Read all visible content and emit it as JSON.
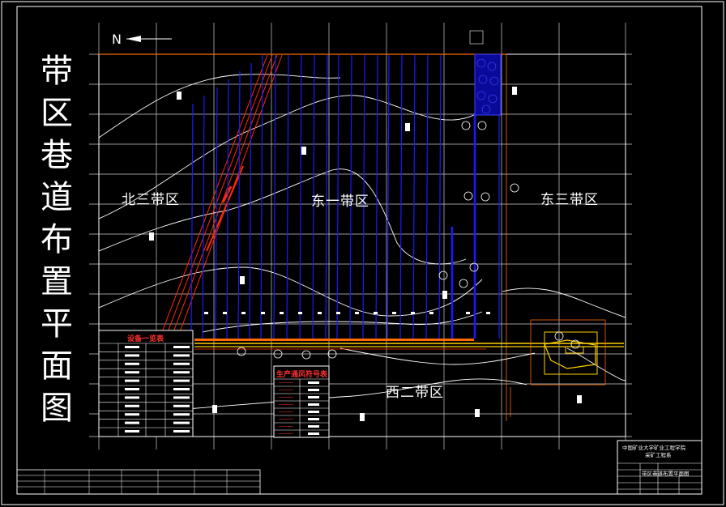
{
  "drawing": {
    "title_chars": [
      "带",
      "区",
      "巷",
      "道",
      "布",
      "置",
      "平",
      "面",
      "图"
    ],
    "north_label": "N",
    "zones": {
      "north_three": "北三带区",
      "east_one": "东一带区",
      "east_three": "东三带区",
      "west_two": "西二带区"
    },
    "equipment_table_title": "设备一览表",
    "ventilation_table_title": "生产通风符号表",
    "title_block": {
      "org_line1": "中国矿业大学矿业工程学院",
      "org_line2": "采矿工程系",
      "drawing_name": "带区巷道布置平面图"
    }
  },
  "colors": {
    "background": "#000000",
    "line": "#ffffff",
    "roadway_blue": "#1a1aff",
    "fault_red": "#ff2a00",
    "main_roadway_yellow": "#ffd000",
    "boundary_orange": "#ff6a00",
    "table_title": "#ff3030"
  }
}
